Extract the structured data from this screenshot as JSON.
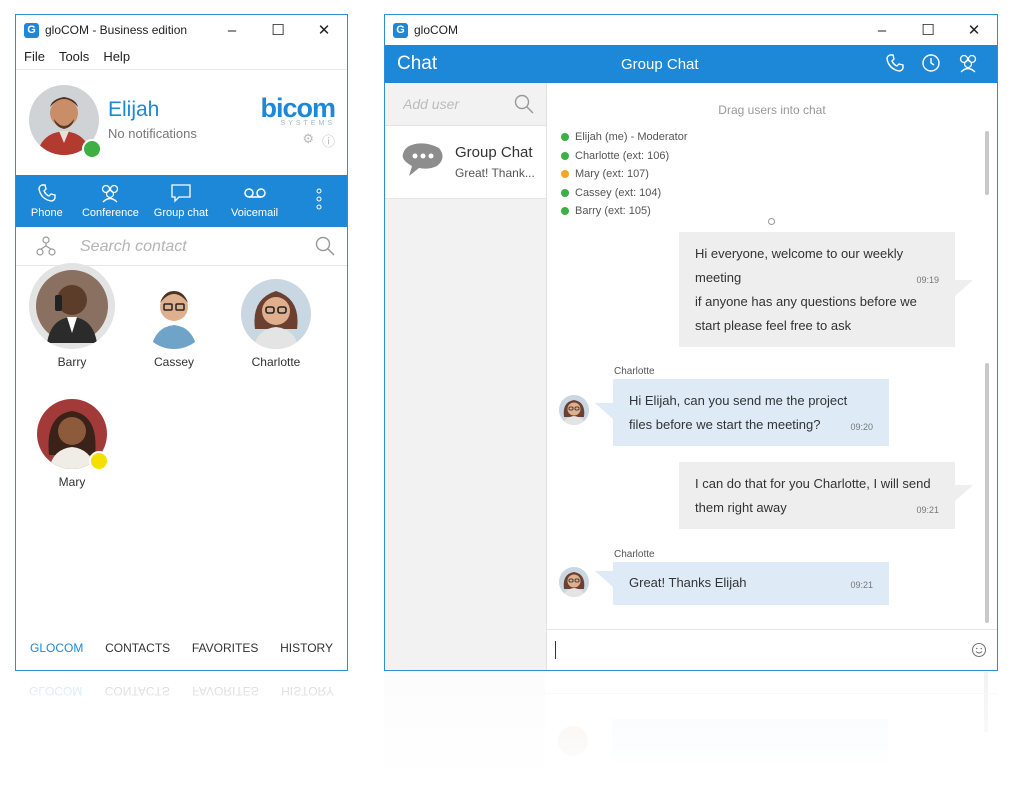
{
  "left_window": {
    "title": "gloCOM - Business edition",
    "app_icon": "G",
    "menu": [
      "File",
      "Tools",
      "Help"
    ],
    "profile": {
      "name": "Elijah",
      "notifications": "No notifications",
      "status_color": "#3cb043"
    },
    "brand": {
      "logo": "bicom",
      "sub": "SYSTEMS"
    },
    "actions": [
      {
        "label": "Phone",
        "icon": "phone-icon"
      },
      {
        "label": "Conference",
        "icon": "conference-icon"
      },
      {
        "label": "Group chat",
        "icon": "group-chat-icon"
      },
      {
        "label": "Voicemail",
        "icon": "voicemail-icon"
      }
    ],
    "search": {
      "placeholder": "Search contact"
    },
    "contacts": [
      {
        "name": "Barry"
      },
      {
        "name": "Cassey"
      },
      {
        "name": "Charlotte"
      },
      {
        "name": "Mary",
        "status_color": "#f3e000"
      }
    ],
    "tabs": [
      "GLOCOM",
      "CONTACTS",
      "FAVORITES",
      "HISTORY"
    ],
    "active_tab": "GLOCOM"
  },
  "right_window": {
    "title": "gloCOM",
    "app_icon": "G",
    "header": {
      "title": "Chat",
      "conversation": "Group Chat"
    },
    "add_user": {
      "placeholder": "Add user"
    },
    "conversations": [
      {
        "name": "Group Chat",
        "preview": "Great! Thank..."
      }
    ],
    "drag_hint": "Drag users into chat",
    "participants": [
      {
        "label": "Elijah (me) - Moderator",
        "color": "#3cb043"
      },
      {
        "label": "Charlotte (ext: 106)",
        "color": "#3cb043"
      },
      {
        "label": "Mary (ext: 107)",
        "color": "#f5a623"
      },
      {
        "label": "Cassey (ext: 104)",
        "color": "#3cb043"
      },
      {
        "label": "Barry (ext: 105)",
        "color": "#3cb043"
      }
    ],
    "messages": [
      {
        "direction": "out",
        "lines": [
          "Hi everyone, welcome to our weekly",
          "meeting",
          "if anyone has any questions before we",
          "start please feel free to ask"
        ],
        "time": "09:19"
      },
      {
        "direction": "in",
        "sender": "Charlotte",
        "lines": [
          "Hi Elijah, can you send me the project",
          "files before we start the meeting?"
        ],
        "time": "09:20"
      },
      {
        "direction": "out",
        "lines": [
          "I can do that for you Charlotte, I will send",
          "them right away"
        ],
        "time": "09:21"
      },
      {
        "direction": "in",
        "sender": "Charlotte",
        "lines": [
          "Great! Thanks Elijah"
        ],
        "time": "09:21"
      }
    ],
    "composer": {
      "value": ""
    }
  },
  "colors": {
    "accent": "#1e88d8",
    "online": "#3cb043",
    "away": "#f5a623",
    "incoming_bubble": "#deebf7",
    "outgoing_bubble": "#eeeeee"
  }
}
